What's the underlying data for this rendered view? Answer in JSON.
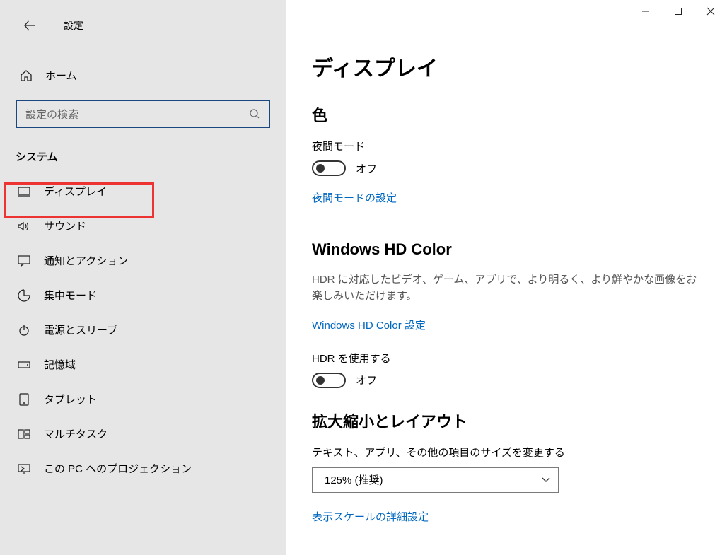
{
  "header": {
    "title": "設定"
  },
  "home": {
    "label": "ホーム"
  },
  "search": {
    "placeholder": "設定の検索"
  },
  "sidebar": {
    "section": "システム",
    "items": [
      {
        "label": "ディスプレイ"
      },
      {
        "label": "サウンド"
      },
      {
        "label": "通知とアクション"
      },
      {
        "label": "集中モード"
      },
      {
        "label": "電源とスリープ"
      },
      {
        "label": "記憶域"
      },
      {
        "label": "タブレット"
      },
      {
        "label": "マルチタスク"
      },
      {
        "label": "この PC へのプロジェクション"
      }
    ]
  },
  "main": {
    "title": "ディスプレイ",
    "color": {
      "heading": "色",
      "night_mode_label": "夜間モード",
      "night_mode_state": "オフ",
      "night_mode_link": "夜間モードの設定"
    },
    "hdcolor": {
      "heading": "Windows HD Color",
      "desc": "HDR に対応したビデオ、ゲーム、アプリで、より明るく、より鮮やかな画像をお楽しみいただけます。",
      "link": "Windows HD Color 設定",
      "use_hdr_label": "HDR を使用する",
      "use_hdr_state": "オフ"
    },
    "scale": {
      "heading": "拡大縮小とレイアウト",
      "resize_label": "テキスト、アプリ、その他の項目のサイズを変更する",
      "dropdown_value": "125% (推奨)",
      "advanced_link": "表示スケールの詳細設定"
    }
  }
}
